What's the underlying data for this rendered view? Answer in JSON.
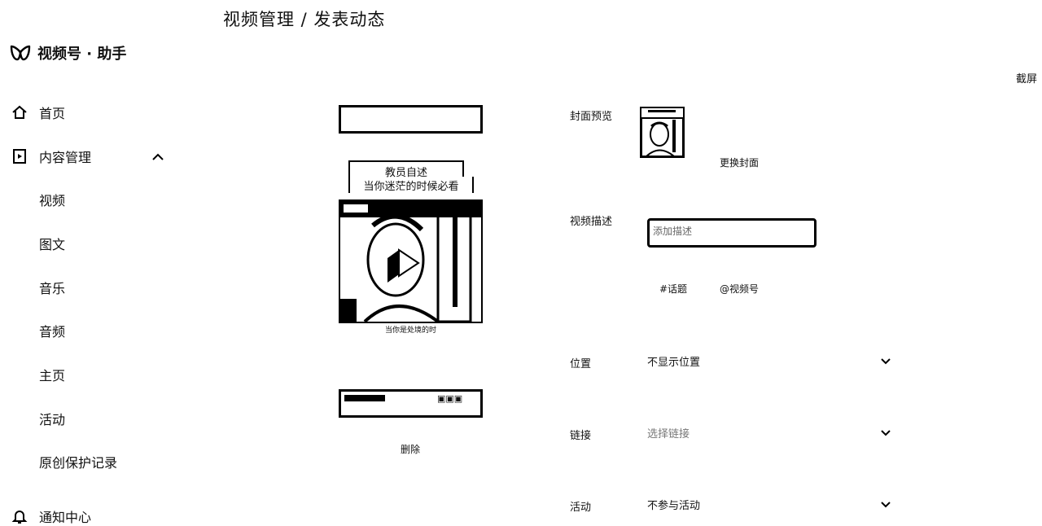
{
  "header": {
    "title": "视频管理 / 发表动态",
    "screenshot_label": "截屏"
  },
  "brand": {
    "name": "视频号 · 助手"
  },
  "sidebar": {
    "home": "首页",
    "content": "内容管理",
    "sub_items": [
      "视频",
      "图文",
      "音乐",
      "音频",
      "主页",
      "活动",
      "原创保护记录"
    ],
    "notifications": "通知中心"
  },
  "preview": {
    "overlay_title": "教员自述",
    "overlay_subtitle": "当你迷茫的时候必看",
    "video_caption": "当你是处境的时",
    "delete_label": "删除"
  },
  "form": {
    "cover_label": "封面预览",
    "replace_cover": "更换封面",
    "desc_label": "视频描述",
    "desc_placeholder": "添加描述",
    "topic_tag": "#话题",
    "mention_tag": "@视频号",
    "location_label": "位置",
    "location_value": "不显示位置",
    "link_label": "链接",
    "link_placeholder": "选择链接",
    "activity_label": "活动",
    "activity_value": "不参与活动"
  }
}
